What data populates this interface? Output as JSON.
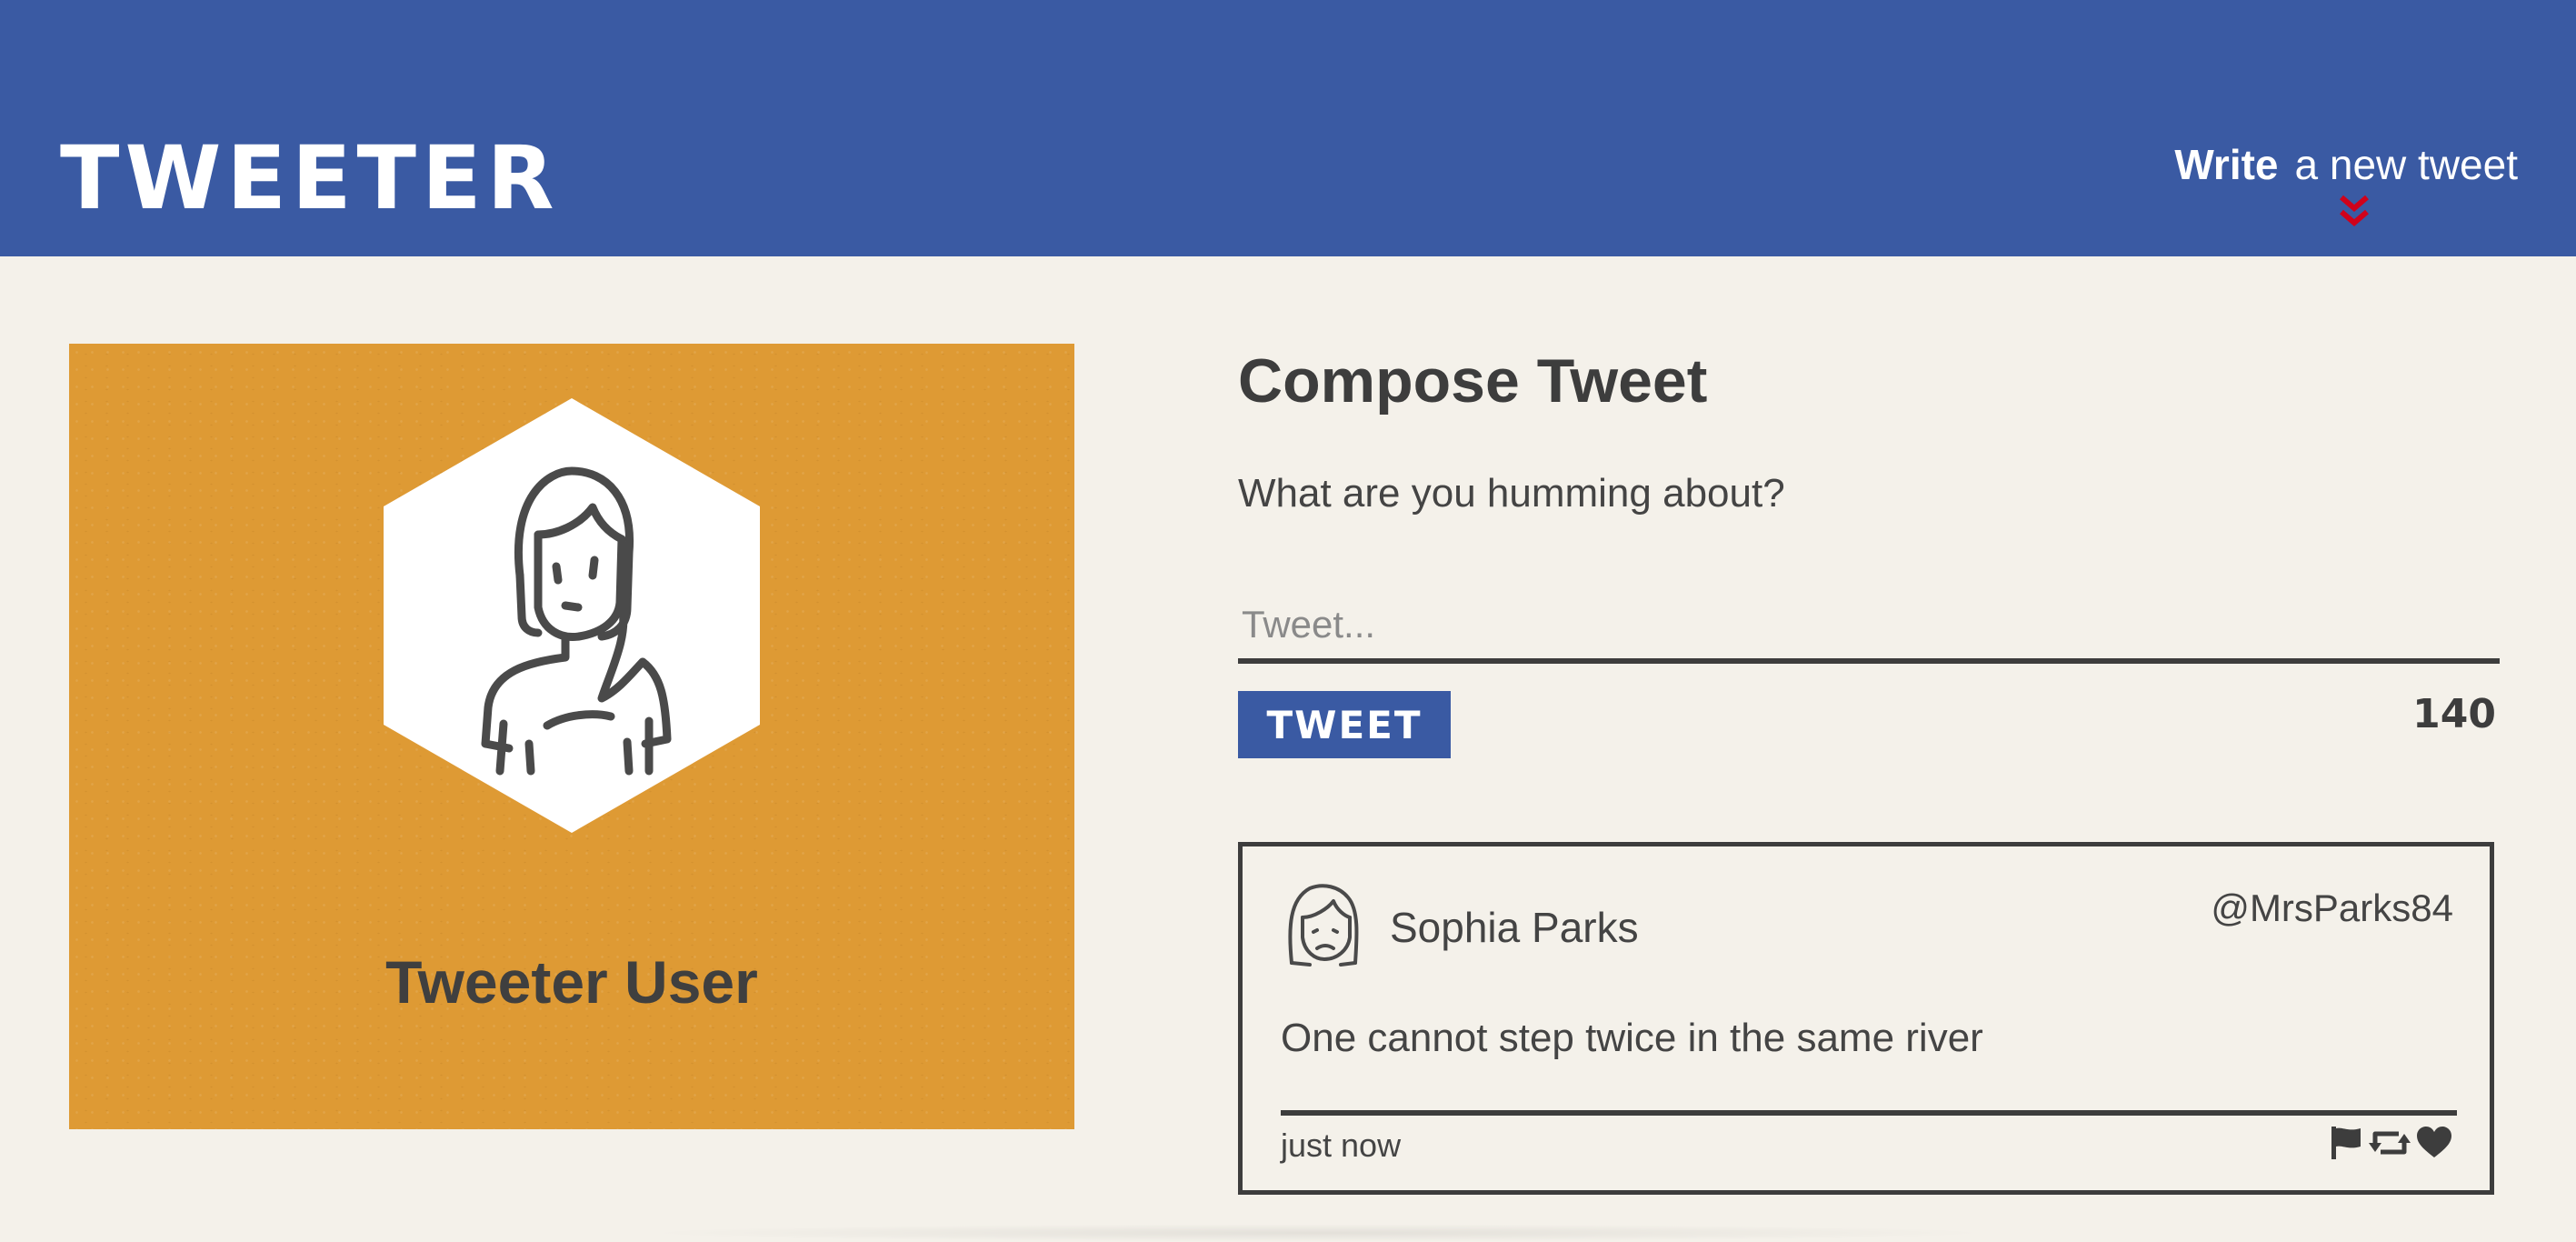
{
  "header": {
    "logo": "TWEETER",
    "nav_write_bold": "Write",
    "nav_write_rest": "a new tweet"
  },
  "profile": {
    "name": "Tweeter User"
  },
  "compose": {
    "title": "Compose Tweet",
    "prompt": "What are you humming about?",
    "input_placeholder": "Tweet...",
    "input_value": "",
    "button_label": "TWEET",
    "char_counter": "140"
  },
  "tweets": [
    {
      "name": "Sophia Parks",
      "handle": "@MrsParks84",
      "text": "One cannot step twice in the same river",
      "time": "just now",
      "actions": [
        "flag-icon",
        "retweet-icon",
        "heart-icon"
      ]
    }
  ],
  "colors": {
    "header": "#3a5aa3",
    "background": "#f4f1ea",
    "profile_card": "#de9a34",
    "arrow": "#d0021b",
    "text_dark": "#3d3d3d"
  }
}
